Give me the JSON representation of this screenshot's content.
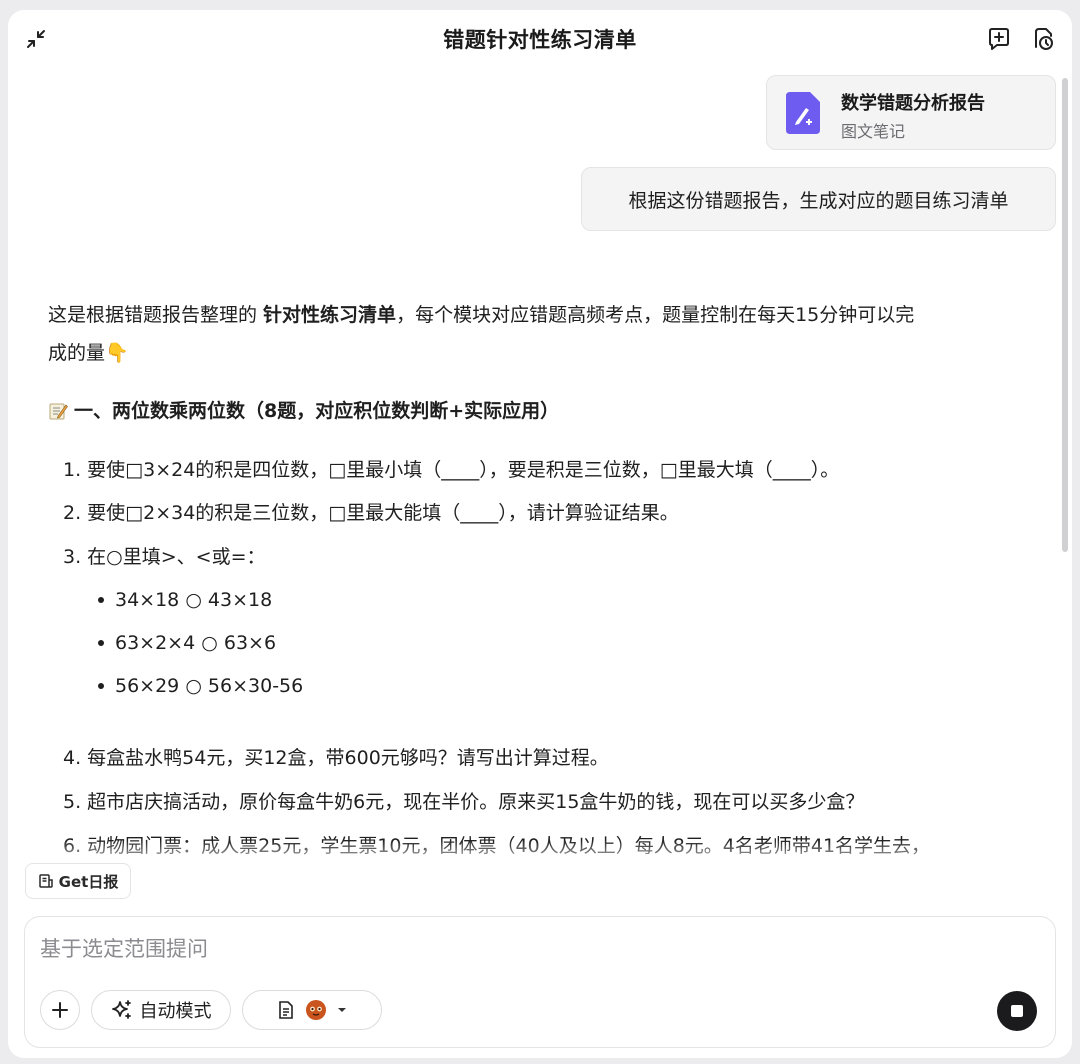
{
  "header": {
    "title": "错题针对性练习清单",
    "left_icon": "collapse-icon",
    "right_icons": [
      "new-chat-icon",
      "history-icon"
    ]
  },
  "attachment": {
    "title": "数学错题分析报告",
    "subtitle": "图文笔记",
    "icon": "note-document-icon",
    "accent": "#6e5cf0"
  },
  "user_message": "根据这份错题报告，生成对应的题目练习清单",
  "answer": {
    "intro_before": "这是根据错题报告整理的 ",
    "intro_bold": "针对性练习清单",
    "intro_after_line1": "，每个模块对应错题高频考点，题量控制在每天15分钟可以完",
    "intro_line2": "成的量",
    "intro_emoji": "👇",
    "section1_title": "一、两位数乘两位数（8题，对应积位数判断+实际应用）",
    "q1": "1. 要使□3×24的积是四位数，□里最小填（____），要是积是三位数，□里最大填（____）。",
    "q2": "2. 要使□2×34的积是三位数，□里最大能填（____），请计算验证结果。",
    "q3": "3. 在○里填>、<或=：",
    "q3_items": [
      "34×18 ○ 43×18",
      "63×2×4 ○ 63×6",
      "56×29 ○ 56×30-56"
    ],
    "q4": "4. 每盒盐水鸭54元，买12盒，带600元够吗？请写出计算过程。",
    "q5": "5. 超市店庆搞活动，原价每盒牛奶6元，现在半价。原来买15盒牛奶的钱，现在可以买多少盒？",
    "q6": "6. 动物园门票：成人票25元，学生票10元，团体票（40人及以上）每人8元。4名老师带41名学生去，"
  },
  "chip_label": "Get日报",
  "composer": {
    "placeholder": "基于选定范围提问",
    "mode_label": "自动模式"
  }
}
